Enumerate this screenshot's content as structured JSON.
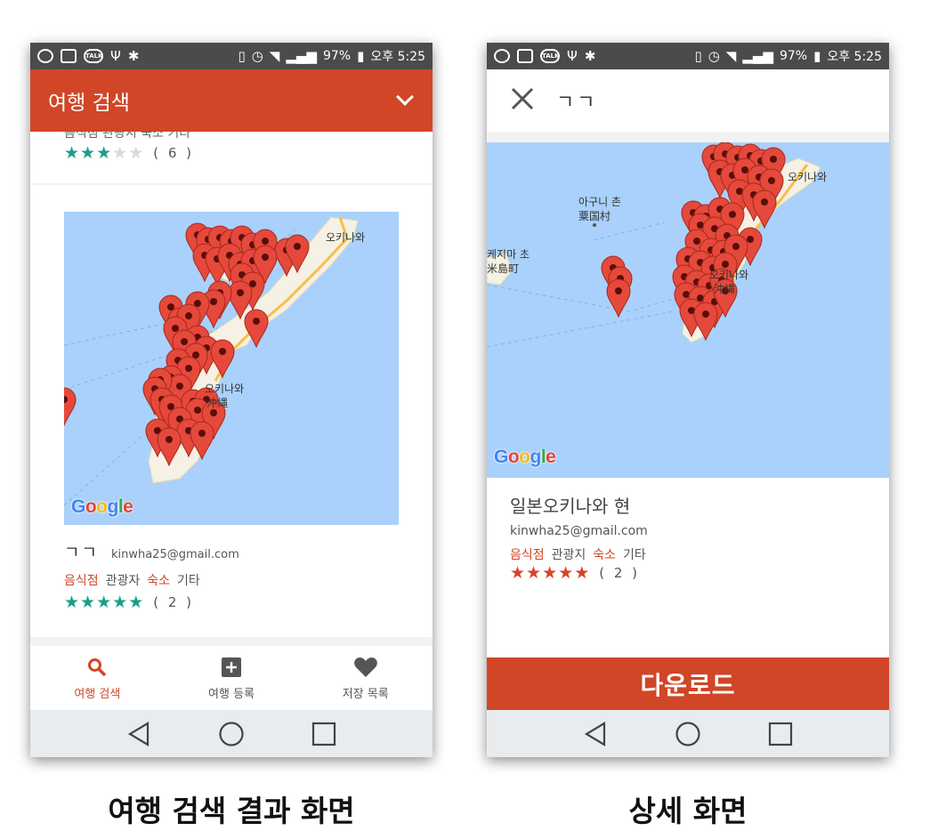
{
  "status_bar": {
    "battery": "97%",
    "time": "오후 5:25",
    "talk_label": "TALK"
  },
  "search_screen": {
    "title": "여행 검색",
    "partial_card": {
      "cut_text": "음식점 관광지 숙소 기타",
      "rating": 3,
      "count": "( 6 )"
    },
    "card": {
      "map_labels": [
        "오키나와",
        "오키나와",
        "沖縄"
      ],
      "google": "Google",
      "nickname": "ㄱㄱ",
      "email": "kinwha25@gmail.com",
      "categories": [
        {
          "label": "음식점",
          "highlight": true
        },
        {
          "label": "관광자",
          "highlight": false
        },
        {
          "label": "숙소",
          "highlight": true
        },
        {
          "label": "기타",
          "highlight": false
        }
      ],
      "rating": 5,
      "count": "( 2 )"
    },
    "bottom_nav": [
      {
        "label": "여행 검색",
        "icon": "search-icon",
        "active": true
      },
      {
        "label": "여행 등록",
        "icon": "plus-box-icon",
        "active": false
      },
      {
        "label": "저장 목록",
        "icon": "heart-icon",
        "active": false
      }
    ]
  },
  "detail_screen": {
    "title": "ㄱㄱ",
    "map_labels": [
      "아구니 촌",
      "粟国村",
      "케지마 초",
      "米島町",
      "오키나와",
      "오키나와",
      "沖縄"
    ],
    "google": "Google",
    "place": "일본오키나와 현",
    "email": "kinwha25@gmail.com",
    "categories": [
      {
        "label": "음식점",
        "highlight": true
      },
      {
        "label": "관광지",
        "highlight": false
      },
      {
        "label": "숙소",
        "highlight": true
      },
      {
        "label": "기타",
        "highlight": false
      }
    ],
    "rating": 5,
    "count": "( 2 )",
    "download_label": "다운로드"
  },
  "captions": {
    "left": "여행 검색 결과 화면",
    "right": "상세 화면"
  },
  "colors": {
    "accent": "#d04627",
    "star_green": "#1a9e8a",
    "map_water": "#a9d1fb",
    "land": "#f5f1e4",
    "pin": "#e5493b"
  }
}
